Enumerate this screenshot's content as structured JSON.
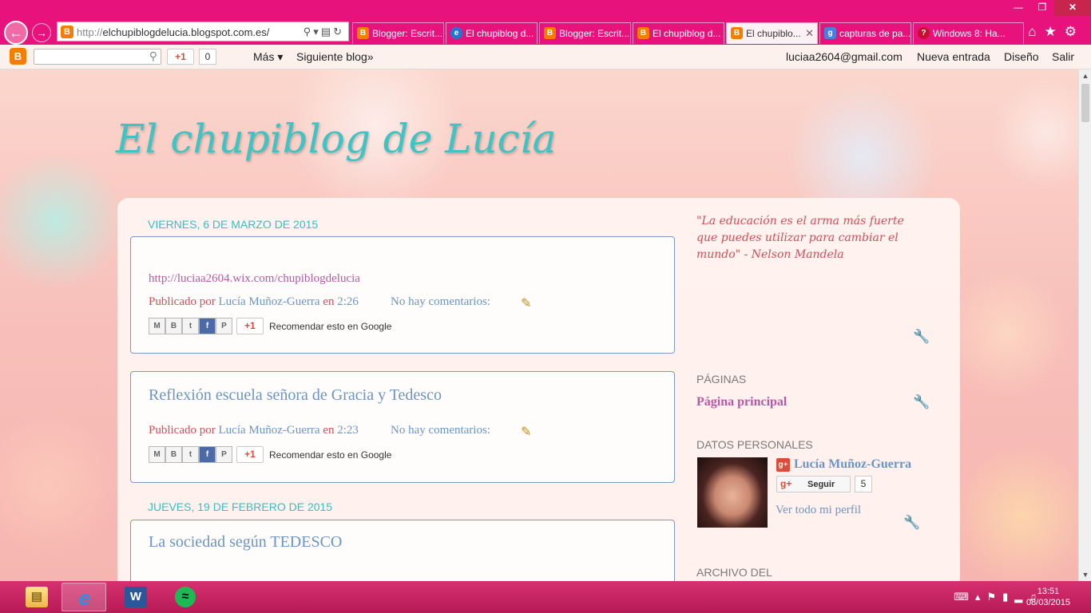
{
  "browser": {
    "address": {
      "protocol": "http://",
      "domain": "elchupiblogdelucia.blogspot.com.es/"
    },
    "tabs": [
      {
        "label": "Blogger: Escrit...",
        "icon": "blogger-icon"
      },
      {
        "label": "El chupiblog d...",
        "icon": "ie-icon"
      },
      {
        "label": "Blogger: Escrit...",
        "icon": "blogger-icon"
      },
      {
        "label": "El chupiblog d...",
        "icon": "blogger-icon"
      },
      {
        "label": "El chupiblo...",
        "icon": "blogger-icon",
        "active": true
      },
      {
        "label": "capturas de pa...",
        "icon": "google-icon"
      },
      {
        "label": "Windows 8: Ha...",
        "icon": "quora-icon"
      }
    ],
    "accent_color": "#e8127c"
  },
  "navbar": {
    "gplus_label": "+1",
    "gplus_count": "0",
    "more_label": "Más ▾",
    "next_blog_label": "Siguiente blog»",
    "user_email": "luciaa2604@gmail.com",
    "new_post_label": "Nueva entrada",
    "design_label": "Diseño",
    "logout_label": "Salir"
  },
  "blog": {
    "title": "El chupiblog de Lucía",
    "date_headers": [
      "VIERNES, 6 DE MARZO DE 2015",
      "JUEVES, 19 DE FEBRERO DE 2015"
    ],
    "posts": [
      {
        "title": "",
        "link_text": "http://luciaa2604.wix.com/chupiblogdelucia",
        "published_by": "Publicado por",
        "author": "Lucía Muñoz-Guerra",
        "at": "en",
        "time": "2:26",
        "comments": "No hay comentarios:",
        "share_recommend": "Recomendar esto en Google",
        "gplus": "+1"
      },
      {
        "title": "Reflexión escuela señora de Gracia y Tedesco",
        "published_by": "Publicado por",
        "author": "Lucía Muñoz-Guerra",
        "at": "en",
        "time": "2:23",
        "comments": "No hay comentarios:",
        "share_recommend": "Recomendar esto en Google",
        "gplus": "+1"
      },
      {
        "title": "La sociedad según TEDESCO"
      }
    ]
  },
  "sidebar": {
    "quote": "\"La educación es el arma más fuerte que puedes utilizar para cambiar el mundo\" - Nelson Mandela",
    "pages_heading": "PÁGINAS",
    "pages_link": "Página principal",
    "profile_heading": "DATOS PERSONALES",
    "profile_name": "Lucía Muñoz-Guerra",
    "follow_label": "Seguir",
    "follow_count": "5",
    "profile_link": "Ver todo mi perfil",
    "archive_heading": "ARCHIVO DEL"
  },
  "taskbar": {
    "time": "13:51",
    "date": "08/03/2015"
  }
}
